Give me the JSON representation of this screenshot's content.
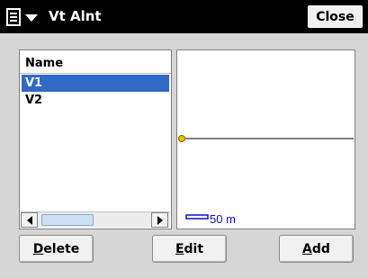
{
  "window": {
    "title": "Vt Alnt",
    "close_label": "Close",
    "menu_icon": "menu-icon"
  },
  "list": {
    "header": "Name",
    "items": [
      {
        "label": "V1",
        "selected": true
      },
      {
        "label": "V2",
        "selected": false
      }
    ]
  },
  "plot": {
    "scale_label": "50 m",
    "colors": {
      "line": "#000000",
      "marker": "#e8c400",
      "scale": "#1010c8"
    }
  },
  "buttons": {
    "delete": {
      "first": "D",
      "rest": "elete"
    },
    "edit": {
      "first": "E",
      "rest": "dit"
    },
    "add": {
      "first": "A",
      "rest": "dd"
    }
  },
  "colors": {
    "titlebar": "#000000",
    "selection": "#3169c6",
    "panel_bg": "#d6d6d6"
  }
}
